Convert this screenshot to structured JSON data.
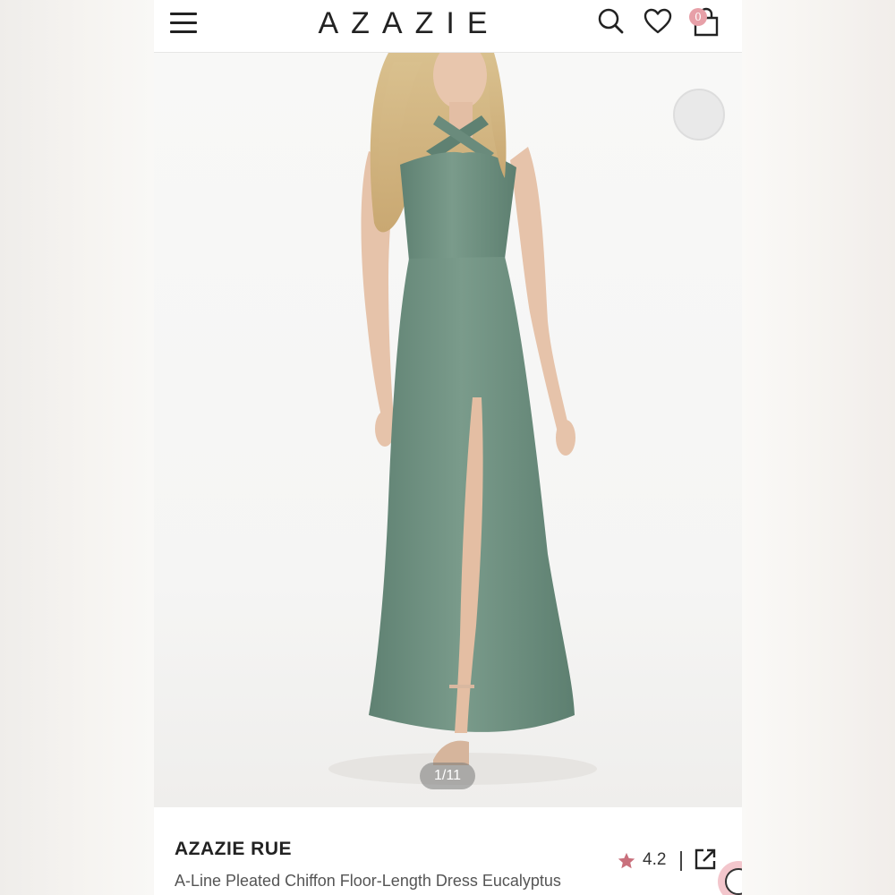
{
  "header": {
    "logo": "AZAZIE",
    "cart_count": "0",
    "icons": [
      "menu-icon",
      "search-icon",
      "heart-icon",
      "shopping-bag-icon"
    ]
  },
  "gallery": {
    "page_indicator": "1/11",
    "dress_color": "#6e9080"
  },
  "product": {
    "brand_name": "AZAZIE RUE",
    "description": "A-Line Pleated Chiffon Floor-Length Dress Eucalyptus",
    "rating": "4.2",
    "rating_star_color": "#c9707c"
  },
  "colors": {
    "accent_pink": "#e7a0a8"
  }
}
